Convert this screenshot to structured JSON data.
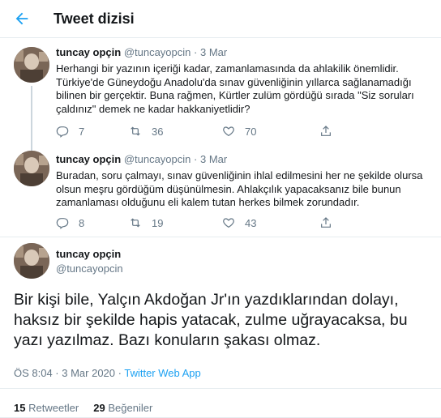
{
  "header": {
    "title": "Tweet dizisi"
  },
  "colors": {
    "accent": "#1da1f2",
    "secondary_text": "#657786",
    "primary_text": "#14171a",
    "border": "#e6ecf0"
  },
  "thread": [
    {
      "name": "tuncay opçin",
      "handle": "@tuncayopcin",
      "dot": "·",
      "date": "3 Mar",
      "text": "Herhangi bir yazının içeriği kadar, zamanlamasında da ahlakilik önemlidir. Türkiye'de Güneydoğu Anadolu'da sınav güvenliğinin yıllarca sağlanamadığı bilinen bir gerçektir. Buna rağmen, Kürtler zulüm gördüğü sırada \"Siz soruları çaldınız\" demek ne kadar hakkaniyetlidir?",
      "replies": "7",
      "retweets": "36",
      "likes": "70"
    },
    {
      "name": "tuncay opçin",
      "handle": "@tuncayopcin",
      "dot": "·",
      "date": "3 Mar",
      "text": "Buradan, soru çalmayı, sınav güvenliğinin ihlal edilmesini her ne şekilde olursa olsun meşru gördüğüm düşünülmesin. Ahlakçılık yapacaksanız bile bunun zamanlaması olduğunu eli kalem tutan herkes bilmek zorundadır.",
      "replies": "8",
      "retweets": "19",
      "likes": "43"
    }
  ],
  "main_tweet": {
    "name": "tuncay opçin",
    "handle": "@tuncayopcin",
    "text": "Bir kişi bile, Yalçın Akdoğan Jr'ın yazdıklarından dolayı, haksız bir şekilde hapis yatacak, zulme uğrayacaksa, bu yazı yazılmaz. Bazı konuların şakası olmaz.",
    "time": "ÖS 8:04 · 3 Mar 2020 ·",
    "app": "Twitter Web App",
    "retweet_count": "15",
    "retweet_label": "Retweetler",
    "like_count": "29",
    "like_label": "Beğeniler"
  },
  "icons": {
    "back": "arrow-left-icon",
    "reply": "reply-icon",
    "retweet": "retweet-icon",
    "like": "heart-icon",
    "share": "share-icon"
  }
}
